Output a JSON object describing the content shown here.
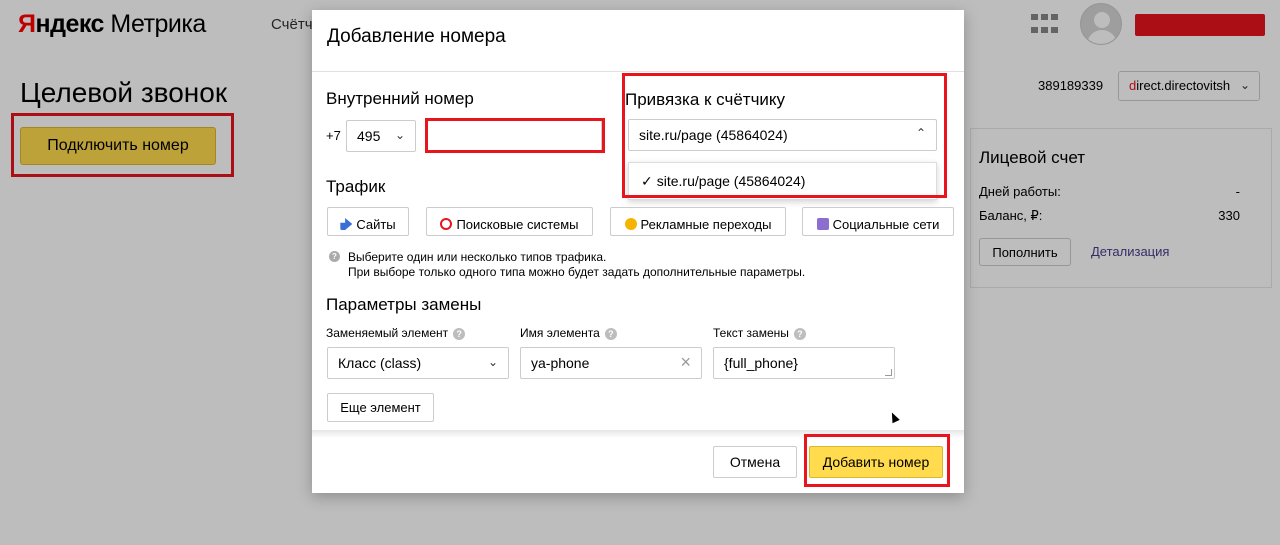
{
  "header": {
    "logo_first": "Я",
    "logo_rest": "ндекс",
    "logo_product": "Метрика",
    "nav_counter": "Счётч"
  },
  "page": {
    "title": "Целевой звонок",
    "connect_button": "Подключить номер",
    "counter_id": "389189339",
    "account_first": "d",
    "account_rest": "irect.directovitsh"
  },
  "balance": {
    "title": "Лицевой счет",
    "work_days_label": "Дней работы:",
    "work_days_value": "-",
    "balance_label": "Баланс, ₽:",
    "balance_value": "330",
    "topup_button": "Пополнить",
    "details_link": "Детализация"
  },
  "modal": {
    "title": "Добавление номера",
    "internal_number_heading": "Внутренний номер",
    "country_code": "+7",
    "area_code": "495",
    "phone_value": "",
    "counter_binding_heading": "Привязка к счётчику",
    "counter_selected": "site.ru/page (45864024)",
    "counter_options": [
      {
        "label": "site.ru/page (45864024)",
        "checked": true
      }
    ],
    "traffic_heading": "Трафик",
    "traffic_types": [
      {
        "label": "Сайты",
        "icon": "arrow-icon",
        "color": "#3b6fd8"
      },
      {
        "label": "Поисковые системы",
        "icon": "search-icon",
        "color": "#e8141e"
      },
      {
        "label": "Рекламные переходы",
        "icon": "coin-icon",
        "color": "#f5b400"
      },
      {
        "label": "Социальные сети",
        "icon": "person-icon",
        "color": "#8a6fd1"
      }
    ],
    "traffic_hint_1": "Выберите один или несколько типов трафика.",
    "traffic_hint_2": "При выборе только одного типа можно будет задать дополнительные параметры.",
    "replace_heading": "Параметры замены",
    "replaced_element_label": "Заменяемый элемент",
    "replaced_element_value": "Класс (class)",
    "element_name_label": "Имя элемента",
    "element_name_value": "ya-phone",
    "replace_text_label": "Текст замены",
    "replace_text_value": "{full_phone}",
    "more_element_button": "Еще элемент",
    "cancel_button": "Отмена",
    "add_button": "Добавить номер"
  },
  "colors": {
    "accent_yellow": "#ffdb4d",
    "highlight_red": "#e8141e",
    "link_purple": "#4b3a8c"
  }
}
